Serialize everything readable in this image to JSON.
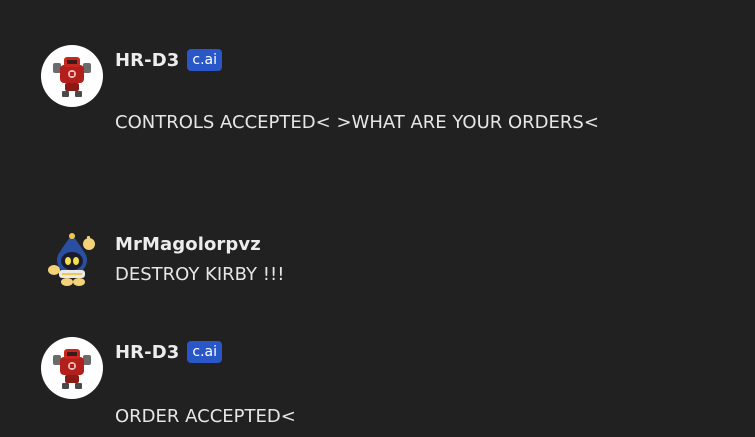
{
  "messages": [
    {
      "author": "HR-D3",
      "badge": "c.ai",
      "text": "CONTROLS ACCEPTED< >WHAT ARE YOUR ORDERS<",
      "avatar_icon": "robot-avatar-icon"
    },
    {
      "author": "MrMagolorpvz",
      "badge": "",
      "text": "DESTROY KIRBY !!!",
      "avatar_icon": "magolor-avatar-icon"
    },
    {
      "author": "HR-D3",
      "badge": "c.ai",
      "text": "ORDER ACCEPTED<",
      "avatar_icon": "robot-avatar-icon"
    }
  ],
  "colors": {
    "background": "#212121",
    "badge": "#2a57c7",
    "text": "#e6e6e6"
  }
}
